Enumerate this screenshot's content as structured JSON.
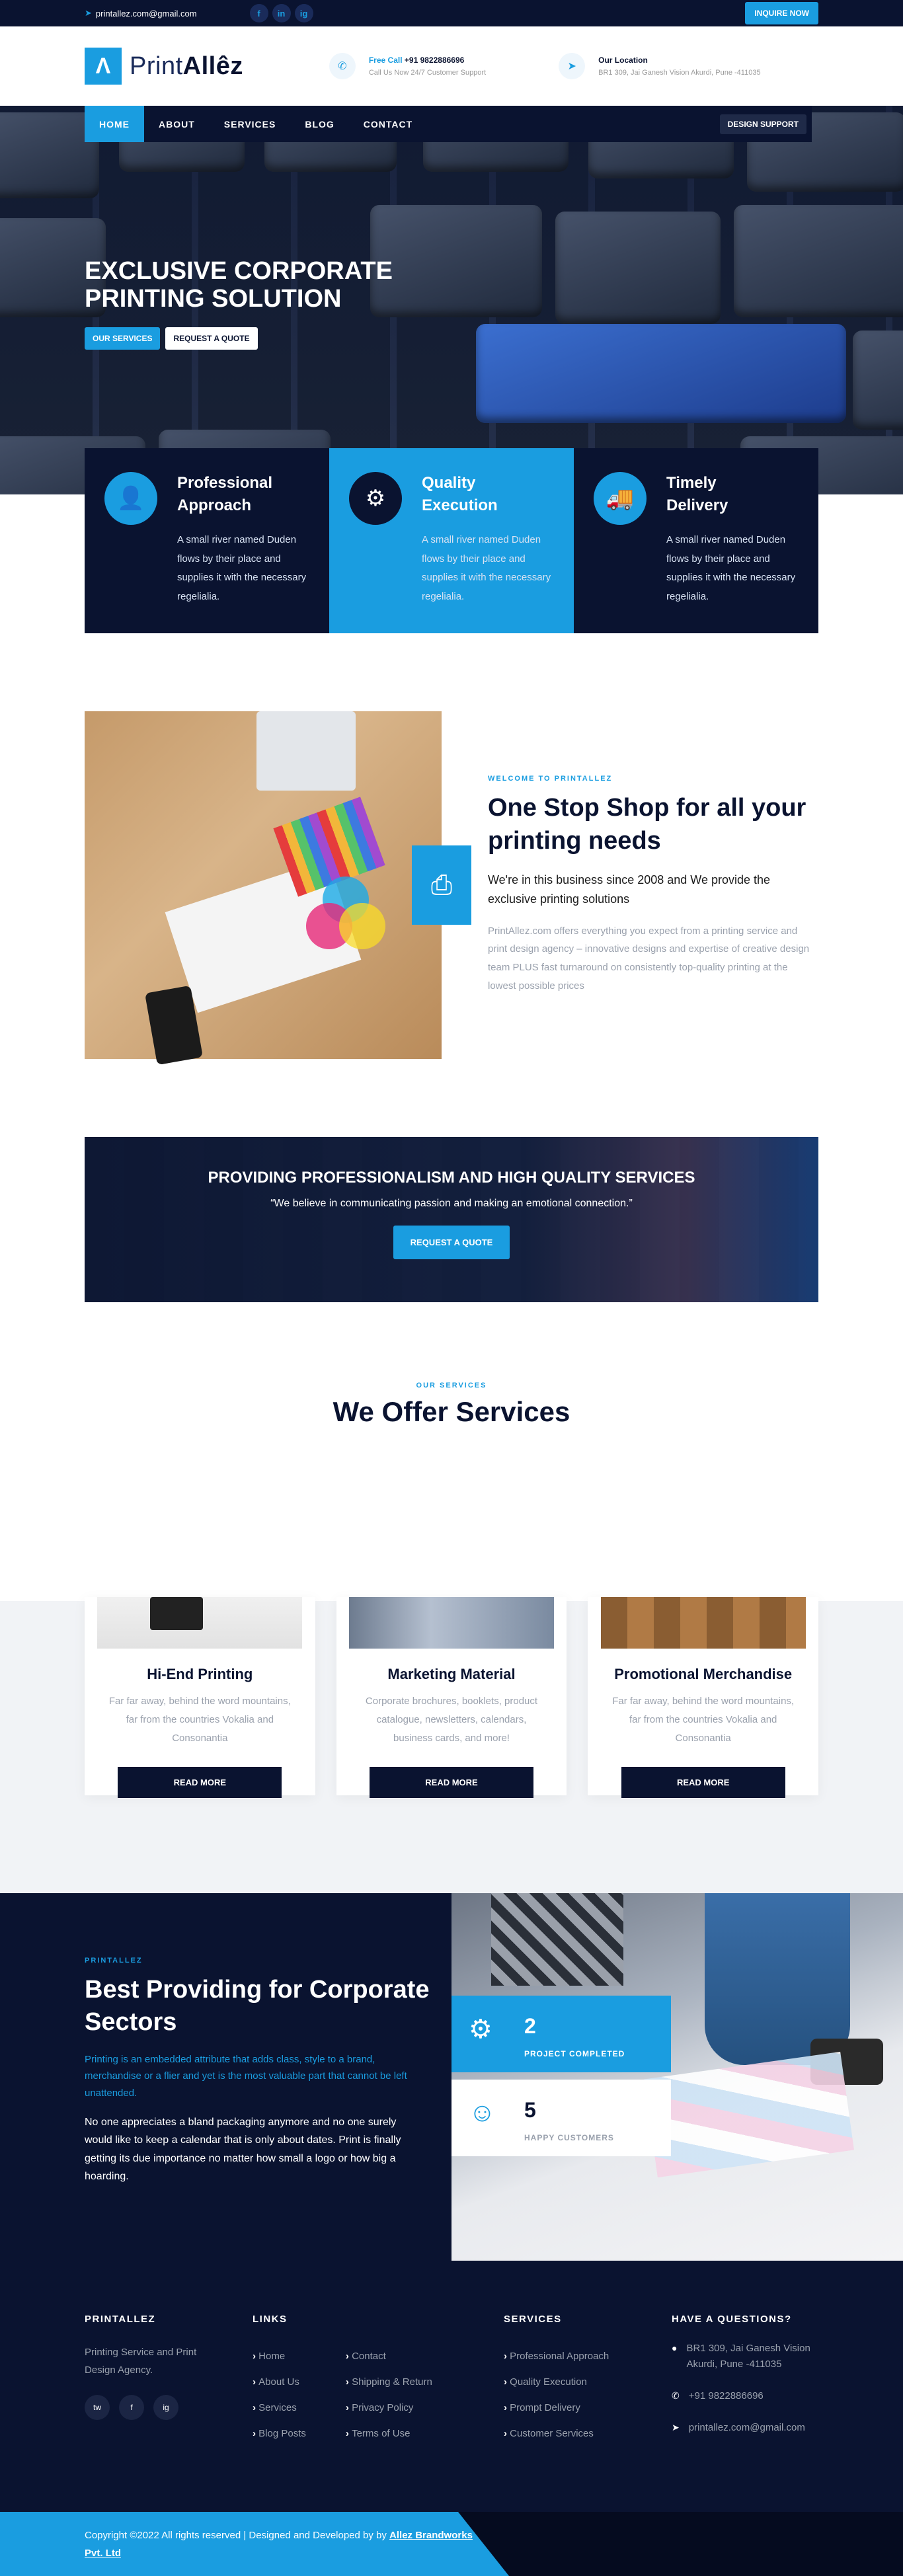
{
  "topbar": {
    "email": "printallez.com@gmail.com",
    "social": [
      "f",
      "in",
      "ig"
    ],
    "inquire_label": "INQUIRE NOW"
  },
  "header": {
    "logo_mark": "Λ",
    "logo_text_light": "Print",
    "logo_text_bold": "Allêz",
    "contact": {
      "label_highlight": "Free Call",
      "phone": "+91 9822886696",
      "subtitle": "Call Us Now 24/7 Customer Support"
    },
    "location": {
      "label": "Our Location",
      "address": "BR1 309, Jai Ganesh Vision Akurdi, Pune -411035"
    }
  },
  "nav": {
    "items": [
      "HOME",
      "ABOUT",
      "SERVICES",
      "BLOG",
      "CONTACT"
    ],
    "active": "HOME",
    "design_support": "DESIGN SUPPORT"
  },
  "hero": {
    "title_line1": "EXCLUSIVE CORPORATE",
    "title_line2": "PRINTING SOLUTION",
    "btn_services": "OUR SERVICES",
    "btn_quote": "REQUEST A QUOTE"
  },
  "features": [
    {
      "title": "Professional Approach",
      "text": "A small river named Duden flows by their place and supplies it with the necessary regelialia.",
      "icon": "user-icon"
    },
    {
      "title": "Quality Execution",
      "text": "A small river named Duden flows by their place and supplies it with the necessary regelialia.",
      "icon": "quality-icon"
    },
    {
      "title": "Timely Delivery",
      "text": "A small river named Duden flows by their place and supplies it with the necessary regelialia.",
      "icon": "truck-icon"
    }
  ],
  "about": {
    "eyebrow": "WELCOME TO PRINTALLEZ",
    "heading": "One Stop Shop for all your printing needs",
    "lead": "We're in this business since 2008 and We provide the exclusive printing solutions",
    "body": "PrintAllez.com offers everything you expect from a printing service and print design agency – innovative designs and expertise of creative design team PLUS fast turnaround on consistently top-quality printing at the lowest possible prices"
  },
  "banner": {
    "title": "PROVIDING PROFESSIONALISM AND HIGH QUALITY SERVICES",
    "quote": "“We believe in communicating passion and making an emotional connection.”",
    "button": "REQUEST A QUOTE"
  },
  "services": {
    "eyebrow": "OUR SERVICES",
    "heading": "We Offer Services",
    "cards": [
      {
        "title": "Hi-End Printing",
        "text": "Far far away, behind the word mountains, far from the countries Vokalia and Consonantia",
        "button": "READ MORE"
      },
      {
        "title": "Marketing Material",
        "text": "Corporate brochures, booklets, product catalogue, newsletters, calendars, business cards, and more!",
        "button": "READ MORE"
      },
      {
        "title": "Promotional Merchandise",
        "text": "Far far away, behind the word mountains, far from the countries Vokalia and Consonantia",
        "button": "READ MORE"
      }
    ]
  },
  "corporate": {
    "eyebrow": "PRINTALLEZ",
    "heading": "Best Providing for Corporate Sectors",
    "blue_text": "Printing is an embedded attribute that adds class, style to a brand, merchandise or a flier and yet is the most valuable part that cannot be left unattended.",
    "white_text": "No one appreciates a bland packaging anymore and no one surely would like to keep a calendar that is only about dates. Print is finally getting its due importance no matter how small a logo or how big a hoarding.",
    "stats": [
      {
        "number": "2",
        "label": "PROJECT COMPLETED"
      },
      {
        "number": "5",
        "label": "HAPPY CUSTOMERS"
      }
    ]
  },
  "footer": {
    "col1_title": "PRINTALLEZ",
    "col1_text": "Printing Service and Print Design Agency.",
    "social": [
      "tw",
      "f",
      "ig"
    ],
    "col2_title": "LINKS",
    "links_a": [
      "Home",
      "About Us",
      "Services",
      "Blog Posts"
    ],
    "links_b": [
      "Contact",
      "Shipping & Return",
      "Privacy Policy",
      "Terms of Use"
    ],
    "col3_title": "SERVICES",
    "services": [
      "Professional Approach",
      "Quality Execution",
      "Prompt Delivery",
      "Customer Services"
    ],
    "col4_title": "HAVE A QUESTIONS?",
    "address": "BR1 309, Jai Ganesh Vision Akurdi, Pune -411035",
    "phone": "+91 9822886696",
    "email": "printallez.com@gmail.com"
  },
  "copyright": {
    "text": "Copyright ©2022 All rights reserved | Designed and Developed by by ",
    "link": "Allez Brandworks Pvt. Ltd"
  },
  "colors": {
    "accent": "#1a9de0",
    "navy": "#0a1330"
  }
}
